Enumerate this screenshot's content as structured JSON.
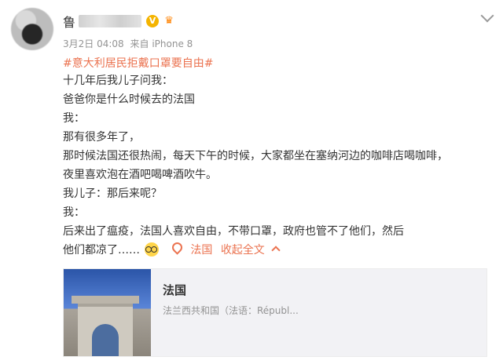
{
  "post": {
    "username_visible": "鲁",
    "verified_badge": "V",
    "level_badge": "icon",
    "meta": {
      "date": "3月2日 04:08",
      "source": "来自 iPhone 8"
    },
    "hashtag": "#意大利居民拒戴口罩要自由#",
    "lines": [
      "十几年后我儿子问我：",
      "爸爸你是什么时候去的法国",
      "我：",
      "那有很多年了，",
      "那时候法国还很热闹，每天下午的时候，大家都坐在塞纳河边的咖啡店喝咖啡，",
      "夜里喜欢泡在酒吧喝啤酒吹牛。",
      "我儿子：那后来呢？",
      "我：",
      "后来出了瘟疫，法国人喜欢自由，不带口罩，政府也管不了他们，然后"
    ],
    "last_line": "他们都凉了……",
    "location_label": "法国",
    "collapse_label": "收起全文",
    "icons": {
      "emoji": "glasses-emoji",
      "location": "location-pin-icon",
      "up": "chevron-up-icon",
      "menu": "chevron-down-icon"
    },
    "colors": {
      "link": "#eb7350",
      "meta": "#939393",
      "text": "#333333"
    }
  },
  "card": {
    "title": "法国",
    "subtitle": "法兰西共和国（法语：Républ..."
  }
}
